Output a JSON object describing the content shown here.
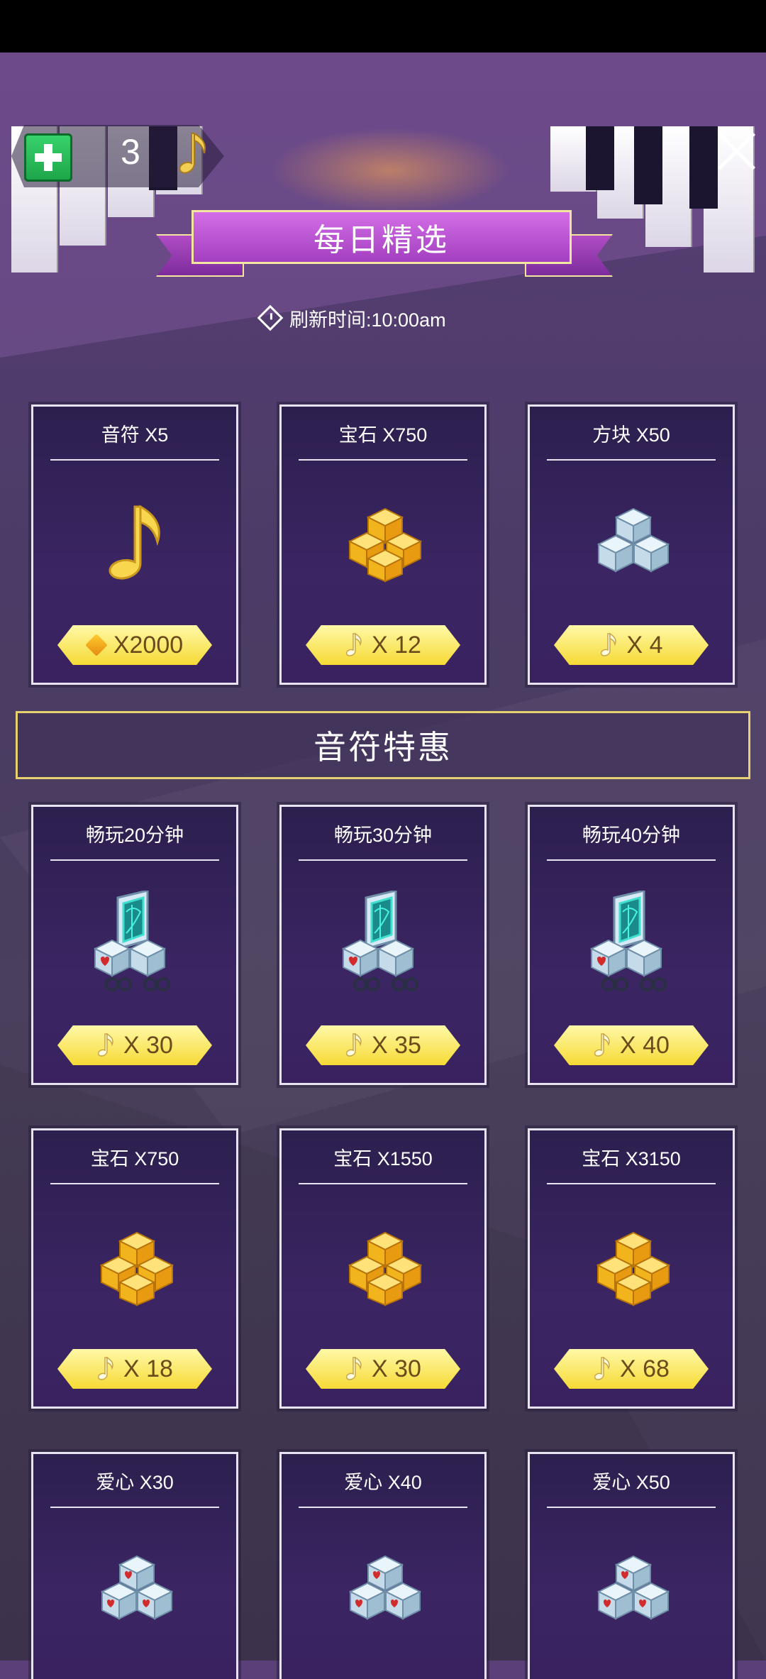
{
  "header": {
    "count": "3",
    "title": "每日精选",
    "refresh_text": "刷新时间:10:00am"
  },
  "daily": [
    {
      "title": "音符 X5",
      "price": "X2000",
      "art": "gold-note-icon",
      "price_icon": "gem-icon"
    },
    {
      "title": "宝石 X750",
      "price": "X 12",
      "art": "gold-gems-icon",
      "price_icon": "note-icon"
    },
    {
      "title": "方块 X50",
      "price": "X 4",
      "art": "blue-cubes-icon",
      "price_icon": "note-icon"
    }
  ],
  "section_title": "音符特惠",
  "deals_row1": [
    {
      "title": "畅玩20分钟",
      "price": "X 30",
      "art": "cube-machine-icon"
    },
    {
      "title": "畅玩30分钟",
      "price": "X 35",
      "art": "cube-machine-icon"
    },
    {
      "title": "畅玩40分钟",
      "price": "X 40",
      "art": "cube-machine-icon"
    }
  ],
  "deals_row2": [
    {
      "title": "宝石 X750",
      "price": "X 18",
      "art": "gold-gems-icon"
    },
    {
      "title": "宝石 X1550",
      "price": "X 30",
      "art": "gold-gems-icon"
    },
    {
      "title": "宝石 X3150",
      "price": "X 68",
      "art": "gold-gems-icon"
    }
  ],
  "deals_row3": [
    {
      "title": "爱心 X30",
      "art": "heart-cubes-icon"
    },
    {
      "title": "爱心 X40",
      "art": "heart-cubes-icon"
    },
    {
      "title": "爱心 X50",
      "art": "heart-cubes-icon"
    }
  ],
  "colors": {
    "accent_purple": "#c358dc",
    "price_yellow": "#f6da35",
    "card_bg": "#2c1f4e",
    "gold": "#ffcb2e"
  }
}
